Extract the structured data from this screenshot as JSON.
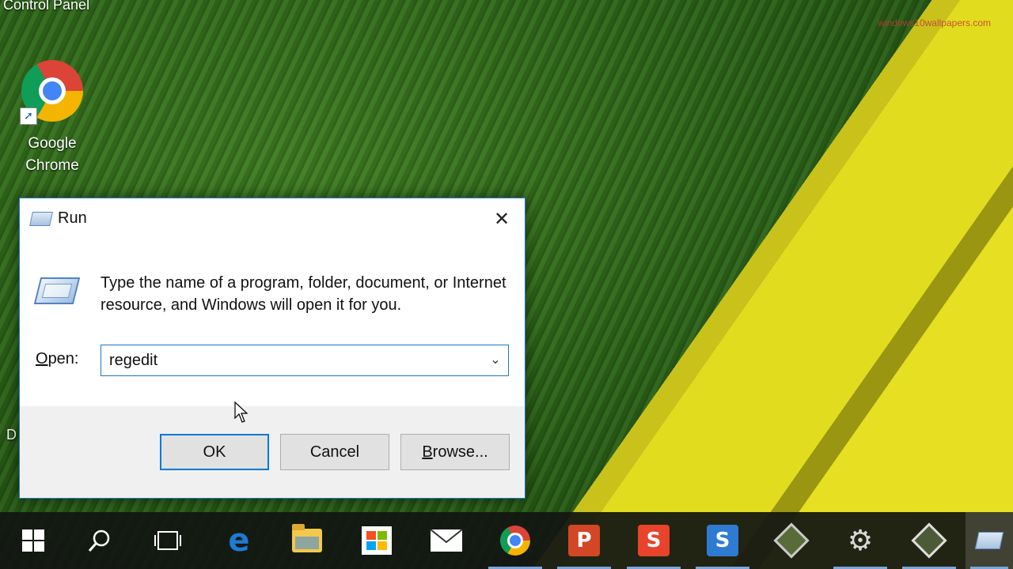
{
  "desktop": {
    "top_left_label": "Control Panel",
    "side_letter": "D",
    "watermark": "windows10wallpapers.com",
    "icons": [
      {
        "label_line1": "Google",
        "label_line2": "Chrome",
        "icon": "chrome-icon"
      }
    ]
  },
  "run_dialog": {
    "title": "Run",
    "description": "Type the name of a program, folder, document, or Internet resource, and Windows will open it for you.",
    "open_label_prefix": "O",
    "open_label_rest": "pen:",
    "open_value": "regedit",
    "ok_label": "OK",
    "cancel_label": "Cancel",
    "browse_label_prefix": "B",
    "browse_label_rest": "rowse...",
    "close_glyph": "✕",
    "dropdown_glyph": "⌄"
  },
  "taskbar": {
    "items": [
      {
        "name": "start-button",
        "icon": "windows-logo-icon"
      },
      {
        "name": "search-button",
        "icon": "search-icon"
      },
      {
        "name": "task-view-button",
        "icon": "task-view-icon"
      },
      {
        "name": "edge-button",
        "icon": "edge-icon"
      },
      {
        "name": "file-explorer-button",
        "icon": "folder-icon"
      },
      {
        "name": "store-button",
        "icon": "store-icon"
      },
      {
        "name": "mail-button",
        "icon": "mail-icon"
      },
      {
        "name": "chrome-button",
        "icon": "chrome-icon"
      },
      {
        "name": "powerpoint-button",
        "icon": "powerpoint-icon",
        "glyph": "P"
      },
      {
        "name": "snagit-button",
        "icon": "snagit-icon",
        "glyph": "S"
      },
      {
        "name": "snagit-editor-button",
        "icon": "snagit-editor-icon",
        "glyph": "S"
      },
      {
        "name": "app-button-1",
        "icon": "diamond-app-icon"
      },
      {
        "name": "settings-button",
        "icon": "gear-icon"
      },
      {
        "name": "recorder-button",
        "icon": "recorder-icon"
      },
      {
        "name": "run-taskbar-button",
        "icon": "run-icon"
      }
    ]
  },
  "colors": {
    "accent": "#0078d7",
    "powerpoint": "#d24726",
    "snagit": "#e8432c",
    "snagit_editor": "#2f7bd1",
    "edge": "#1e7ad4"
  }
}
